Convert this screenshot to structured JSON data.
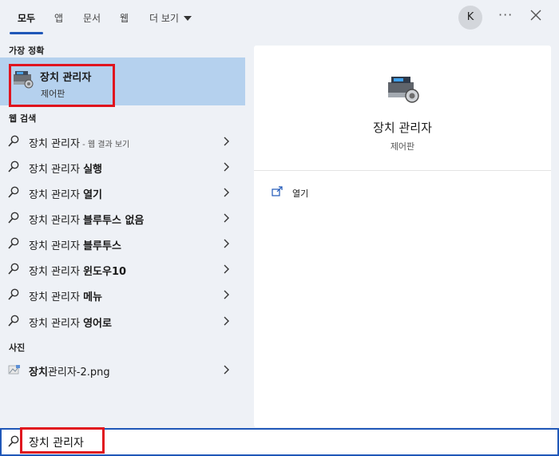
{
  "tabs": [
    {
      "label": "모두",
      "active": true
    },
    {
      "label": "앱"
    },
    {
      "label": "문서"
    },
    {
      "label": "웹"
    },
    {
      "label": "더 보기"
    }
  ],
  "account": {
    "initial": "K"
  },
  "toolbar": {
    "more_icon": "more-icon",
    "close_icon": "close-icon"
  },
  "best_match": {
    "section_label": "가장 정확",
    "title": "장치 관리자",
    "subtitle": "제어판",
    "icon": "device-manager-icon"
  },
  "web_search": {
    "section_label": "웹 검색",
    "items": [
      {
        "prefix": "장치 관리자",
        "suffix": "",
        "hint": " - 웹 결과 보기"
      },
      {
        "prefix": "장치 관리자 ",
        "suffix": "실행",
        "hint": ""
      },
      {
        "prefix": "장치 관리자 ",
        "suffix": "열기",
        "hint": ""
      },
      {
        "prefix": "장치 관리자 ",
        "suffix": "블루투스 없음",
        "hint": ""
      },
      {
        "prefix": "장치 관리자 ",
        "suffix": "블루투스",
        "hint": ""
      },
      {
        "prefix": "장치 관리자 ",
        "suffix": "윈도우10",
        "hint": ""
      },
      {
        "prefix": "장치 관리자 ",
        "suffix": "메뉴",
        "hint": ""
      },
      {
        "prefix": "장치 관리자 ",
        "suffix": "영어로",
        "hint": ""
      }
    ]
  },
  "photos": {
    "section_label": "사진",
    "items": [
      {
        "bold": "장치",
        "rest": "관리자-2.png"
      }
    ]
  },
  "preview": {
    "title": "장치 관리자",
    "subtitle": "제어판",
    "actions": [
      {
        "label": "열기",
        "icon": "open-icon"
      }
    ]
  },
  "search": {
    "value": "장치 관리자"
  },
  "colors": {
    "accent": "#1f57b8",
    "selected_bg": "#b5d1ee",
    "highlight_box": "#e0141e",
    "background": "#eef1f6"
  }
}
